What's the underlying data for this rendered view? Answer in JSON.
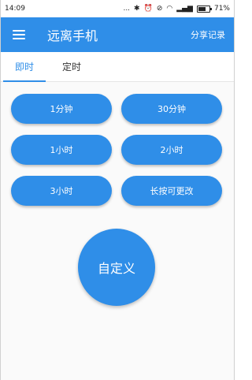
{
  "status_bar": {
    "time": "14:09",
    "icons_text": "...",
    "battery_text": "71%"
  },
  "app_bar": {
    "title": "远离手机",
    "share_label": "分享记录"
  },
  "tabs": [
    {
      "label": "即时",
      "active": true
    },
    {
      "label": "定时",
      "active": false
    }
  ],
  "timer_buttons": [
    {
      "label": "1分钟"
    },
    {
      "label": "30分钟"
    },
    {
      "label": "1小时"
    },
    {
      "label": "2小时"
    },
    {
      "label": "3小时"
    },
    {
      "label": "长按可更改"
    }
  ],
  "custom_button": {
    "label": "自定义"
  },
  "colors": {
    "primary": "#2f8ee8",
    "background": "#fafafa",
    "on_primary": "#ffffff"
  }
}
